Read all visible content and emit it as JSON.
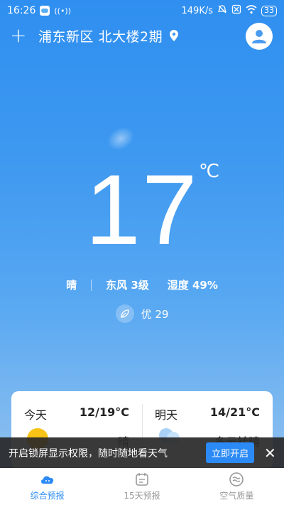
{
  "status_bar": {
    "time": "16:26",
    "network_speed": "149K/s",
    "battery": "33"
  },
  "header": {
    "add_icon": "+",
    "location": "浦东新区 北大楼2期"
  },
  "weather": {
    "temperature": "17",
    "unit": "℃",
    "condition": "晴",
    "wind": "东风 3级",
    "humidity": "湿度 49%",
    "aqi_label": "优 29"
  },
  "forecast": {
    "today": {
      "label": "今天",
      "temp": "12/19°C",
      "condition": "晴"
    },
    "tomorrow": {
      "label": "明天",
      "temp": "14/21°C",
      "condition": "多云转晴"
    }
  },
  "banner": {
    "text": "开启锁屏显示权限，随时随地看天气",
    "button": "立即开启",
    "close": "✕"
  },
  "nav": {
    "items": [
      {
        "label": "综合预报",
        "icon": "cloud-face-icon",
        "active": true
      },
      {
        "label": "15天预报",
        "icon": "calendar-icon",
        "active": false
      },
      {
        "label": "空气质量",
        "icon": "wind-icon",
        "active": false
      }
    ]
  },
  "colors": {
    "accent": "#2b8af5",
    "sky_top": "#2f8ff0",
    "sun": "#f8c317"
  }
}
